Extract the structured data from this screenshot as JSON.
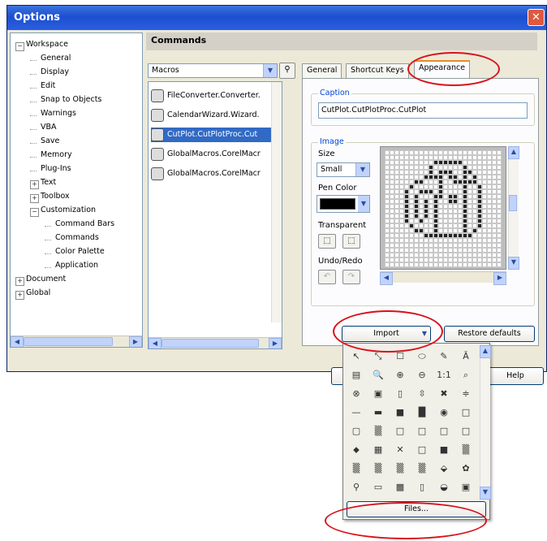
{
  "window": {
    "title": "Options",
    "close_symbol": "✕"
  },
  "tree": {
    "items": [
      {
        "label": "Workspace",
        "expander": "⊟"
      },
      {
        "label": "General"
      },
      {
        "label": "Display"
      },
      {
        "label": "Edit"
      },
      {
        "label": "Snap to Objects"
      },
      {
        "label": "Warnings"
      },
      {
        "label": "VBA"
      },
      {
        "label": "Save"
      },
      {
        "label": "Memory"
      },
      {
        "label": "Plug-Ins"
      },
      {
        "label": "Text",
        "expander": "⊞"
      },
      {
        "label": "Toolbox",
        "expander": "⊞"
      },
      {
        "label": "Customization",
        "expander": "⊟"
      },
      {
        "label": "Command Bars"
      },
      {
        "label": "Commands"
      },
      {
        "label": "Color Palette"
      },
      {
        "label": "Application"
      },
      {
        "label": "Document",
        "expander": "⊞"
      },
      {
        "label": "Global",
        "expander": "⊞"
      }
    ]
  },
  "commands": {
    "header": "Commands",
    "category": "Macros",
    "list": [
      "FileConverter.Converter.",
      "CalendarWizard.Wizard.",
      "CutPlot.CutPlotProc.Cut",
      "GlobalMacros.CorelMacr",
      "GlobalMacros.CorelMacr"
    ]
  },
  "tabs": [
    "General",
    "Shortcut Keys",
    "Appearance"
  ],
  "caption": {
    "label": "Caption",
    "value": "CutPlot.CutPlotProc.CutPlot"
  },
  "image": {
    "label": "Image",
    "size_label": "Size",
    "size_value": "Small",
    "pen_color_label": "Pen Color",
    "pen_color": "#000000",
    "transparent_label": "Transparent",
    "undo_redo_label": "Undo/Redo"
  },
  "buttons": {
    "import": "Import",
    "restore": "Restore defaults",
    "help": "Help",
    "files": "Files..."
  },
  "colors": {
    "highlight": "#316ac5",
    "annotation": "#d9121a",
    "tab_accent": "#e68b2c",
    "group_label": "#0046d5"
  },
  "popup_tools": [
    "↖",
    "⤡",
    "☐",
    "⬭",
    "✎",
    "Ā",
    "▤",
    "🔍",
    "⊕",
    "⊖",
    "1:1",
    "⌕",
    "⊗",
    "▣",
    "▯",
    "⇳",
    "✖",
    "≑",
    "—",
    "▬",
    "■",
    "█",
    "◉",
    "□",
    "▢",
    "▒",
    "□",
    "□",
    "□",
    "□",
    "⬥",
    "▦",
    "✕",
    "□",
    "■",
    "▒",
    "▒",
    "▒",
    "▒",
    "▒",
    "⬙",
    "✿",
    "⚲",
    "▭",
    "▩",
    "▯",
    "◒",
    "▣"
  ]
}
